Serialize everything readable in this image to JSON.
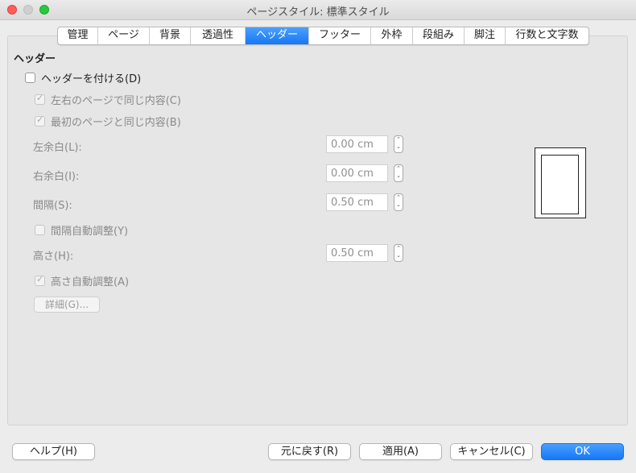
{
  "window": {
    "title": "ページスタイル: 標準スタイル"
  },
  "tabs": [
    {
      "label": "管理"
    },
    {
      "label": "ページ"
    },
    {
      "label": "背景"
    },
    {
      "label": "透過性"
    },
    {
      "label": "ヘッダー",
      "active": true
    },
    {
      "label": "フッター"
    },
    {
      "label": "外枠"
    },
    {
      "label": "段組み"
    },
    {
      "label": "脚注"
    },
    {
      "label": "行数と文字数"
    }
  ],
  "header": {
    "section_title": "ヘッダー",
    "header_on_label": "ヘッダーを付ける(D)",
    "same_left_right_label": "左右のページで同じ内容(C)",
    "same_first_label": "最初のページと同じ内容(B)",
    "left_margin_label": "左余白(L):",
    "left_margin_value": "0.00 cm",
    "right_margin_label": "右余白(I):",
    "right_margin_value": "0.00 cm",
    "spacing_label": "間隔(S):",
    "spacing_value": "0.50 cm",
    "dynamic_spacing_label": "間隔自動調整(Y)",
    "height_label": "高さ(H):",
    "height_value": "0.50 cm",
    "autofit_height_label": "高さ自動調整(A)",
    "more_button": "詳細(G)..."
  },
  "buttons": {
    "help": "ヘルプ(H)",
    "reset": "元に戻す(R)",
    "apply": "適用(A)",
    "cancel": "キャンセル(C)",
    "ok": "OK"
  },
  "colors": {
    "accent": "#1677f5",
    "close": "#fe5f57",
    "maximize": "#28c840"
  },
  "icons": {
    "stepper": "up-down-arrows-icon",
    "checkmark": "checkmark-icon"
  }
}
